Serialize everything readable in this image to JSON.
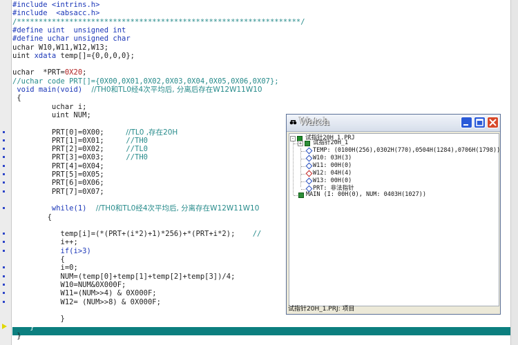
{
  "editor": {
    "lines": [
      {
        "parts": [
          [
            "pp",
            "#include <intrins.h>"
          ]
        ]
      },
      {
        "parts": [
          [
            "pp",
            "#include  <absacc.h>"
          ]
        ]
      },
      {
        "parts": [
          [
            "cm",
            "/*****************************************************************/"
          ]
        ]
      },
      {
        "parts": [
          [
            "pp",
            "#define uint  unsigned int"
          ]
        ]
      },
      {
        "parts": [
          [
            "pp",
            "#define uchar unsigned char"
          ]
        ]
      },
      {
        "parts": [
          [
            "",
            "uchar W10,W11,W12,W13;"
          ]
        ]
      },
      {
        "parts": [
          [
            "",
            "uint "
          ],
          [
            "kw",
            "xdata"
          ],
          [
            "",
            " temp[]={0,0,0,0};"
          ]
        ]
      },
      {
        "parts": [
          [
            "",
            ""
          ]
        ]
      },
      {
        "parts": [
          [
            "",
            "uchar  *PRT="
          ],
          [
            "nm",
            "0X20"
          ],
          [
            "",
            ";"
          ]
        ]
      },
      {
        "parts": [
          [
            "cm",
            "//uchar code PRT[]={0X00,0X01,0X02,0X03,0X04,0X05,0X06,0X07};"
          ]
        ]
      },
      {
        "parts": [
          [
            "kw",
            " void main(void)"
          ],
          [
            "cm",
            "    //TH0和TL0经4次平均后, 分离后存在W12W11W10"
          ]
        ]
      },
      {
        "parts": [
          [
            "",
            " {"
          ]
        ]
      },
      {
        "parts": [
          [
            "",
            "         uchar i;"
          ]
        ]
      },
      {
        "parts": [
          [
            "",
            "         uint NUM;"
          ]
        ]
      },
      {
        "parts": [
          [
            "",
            ""
          ]
        ]
      },
      {
        "parts": [
          [
            "",
            "         PRT[0]=0X00;     "
          ],
          [
            "cm",
            "//TL0 ,存在20H"
          ]
        ]
      },
      {
        "parts": [
          [
            "",
            "         PRT[1]=0X01;     "
          ],
          [
            "cm",
            "//TH0"
          ]
        ]
      },
      {
        "parts": [
          [
            "",
            "         PRT[2]=0X02;     "
          ],
          [
            "cm",
            "//TL0"
          ]
        ]
      },
      {
        "parts": [
          [
            "",
            "         PRT[3]=0X03;     "
          ],
          [
            "cm",
            "//TH0"
          ]
        ]
      },
      {
        "parts": [
          [
            "",
            "         PRT[4]=0X04;"
          ]
        ]
      },
      {
        "parts": [
          [
            "",
            "         PRT[5]=0X05;"
          ]
        ]
      },
      {
        "parts": [
          [
            "",
            "         PRT[6]=0X06;"
          ]
        ]
      },
      {
        "parts": [
          [
            "",
            "         PRT[7]=0X07;"
          ]
        ]
      },
      {
        "parts": [
          [
            "",
            ""
          ]
        ]
      },
      {
        "parts": [
          [
            "kw",
            "         while(1)"
          ],
          [
            "cm",
            "    //TH0和TL0经4次平均后, 分离存在W12W11W10"
          ]
        ]
      },
      {
        "parts": [
          [
            "",
            "        {"
          ]
        ]
      },
      {
        "parts": [
          [
            "",
            ""
          ]
        ]
      },
      {
        "parts": [
          [
            "",
            "           temp[i]=(*(PRT+(i*2)+1)*256)+*(PRT+i*2);    "
          ],
          [
            "cm",
            "//"
          ]
        ]
      },
      {
        "parts": [
          [
            "",
            "           i++;"
          ]
        ]
      },
      {
        "parts": [
          [
            "kw",
            "           if(i>3)"
          ]
        ]
      },
      {
        "parts": [
          [
            "",
            "           {"
          ]
        ]
      },
      {
        "parts": [
          [
            "",
            "           i=0;"
          ]
        ]
      },
      {
        "parts": [
          [
            "",
            "           NUM=(temp[0]+temp[1]+temp[2]+temp[3])/4;"
          ]
        ]
      },
      {
        "parts": [
          [
            "",
            "           W10=NUM&0X000F;"
          ]
        ]
      },
      {
        "parts": [
          [
            "",
            "           W11=(NUM>>4) & 0X000F;"
          ]
        ]
      },
      {
        "parts": [
          [
            "",
            "           W12= (NUM>>8) & 0X000F;"
          ]
        ]
      },
      {
        "parts": [
          [
            "",
            ""
          ]
        ]
      },
      {
        "parts": [
          [
            "",
            "           }"
          ]
        ]
      },
      {
        "parts": [
          [
            "",
            "    }"
          ]
        ]
      },
      {
        "parts": [
          [
            "",
            " }"
          ]
        ]
      }
    ]
  },
  "watch": {
    "title": "Watch",
    "project": "试指针20H_1.PRJ",
    "module": "试指针20H_1",
    "vars": [
      {
        "text": "TEMP: (0100H(256),0302H(770),0504H(1284),0706H(1798))",
        "red": false
      },
      {
        "text": "W10: 03H(3)",
        "red": false
      },
      {
        "text": "W11: 00H(0)",
        "red": false
      },
      {
        "text": "W12: 04H(4)",
        "red": true
      },
      {
        "text": "W13: 00H(0)",
        "red": false
      },
      {
        "text": "PRT: 非法指针",
        "red": false
      }
    ],
    "main_row": "MAIN (I: 00H(0), NUM: 0403H(1027))",
    "status": "试指针20H_1.PRJ: 项目"
  },
  "colors": {
    "keyword": "#1a36b8",
    "comment": "#258a8a",
    "current_line": "#0c7f7f"
  }
}
